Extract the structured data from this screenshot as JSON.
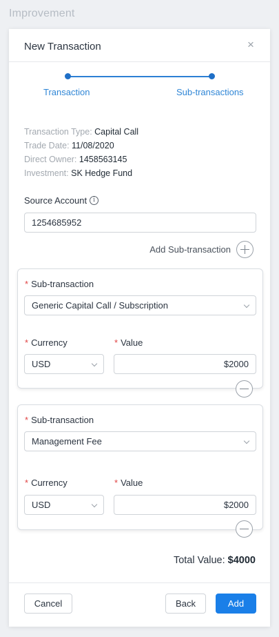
{
  "page": {
    "title": "Improvement"
  },
  "modal": {
    "title": "New Transaction",
    "close_glyph": "×",
    "steps": [
      {
        "label": "Transaction"
      },
      {
        "label": "Sub-transactions"
      }
    ],
    "info": {
      "transaction_type_key": "Transaction Type:",
      "transaction_type_val": "Capital Call",
      "trade_date_key": "Trade Date:",
      "trade_date_val": "11/08/2020",
      "direct_owner_key": "Direct Owner:",
      "direct_owner_val": "1458563145",
      "investment_key": "Investment:",
      "investment_val": "SK Hedge Fund"
    },
    "source_account": {
      "label": "Source Account",
      "value": "1254685952"
    },
    "add_sub_label": "Add Sub-transaction",
    "sub_transactions": [
      {
        "sub_label": "Sub-transaction",
        "sub_value": "Generic Capital Call / Subscription",
        "currency_label": "Currency",
        "currency_value": "USD",
        "value_label": "Value",
        "value_value": "$2000"
      },
      {
        "sub_label": "Sub-transaction",
        "sub_value": "Management Fee",
        "currency_label": "Currency",
        "currency_value": "USD",
        "value_label": "Value",
        "value_value": "$2000"
      }
    ],
    "required_mark": "*",
    "total": {
      "label": "Total Value:",
      "value": "$4000"
    },
    "footer": {
      "cancel": "Cancel",
      "back": "Back",
      "add": "Add"
    }
  },
  "colors": {
    "accent": "#1a7fe8",
    "step_line": "#2b7fd4",
    "required": "#e04545",
    "muted_text": "#a3a9b0"
  }
}
